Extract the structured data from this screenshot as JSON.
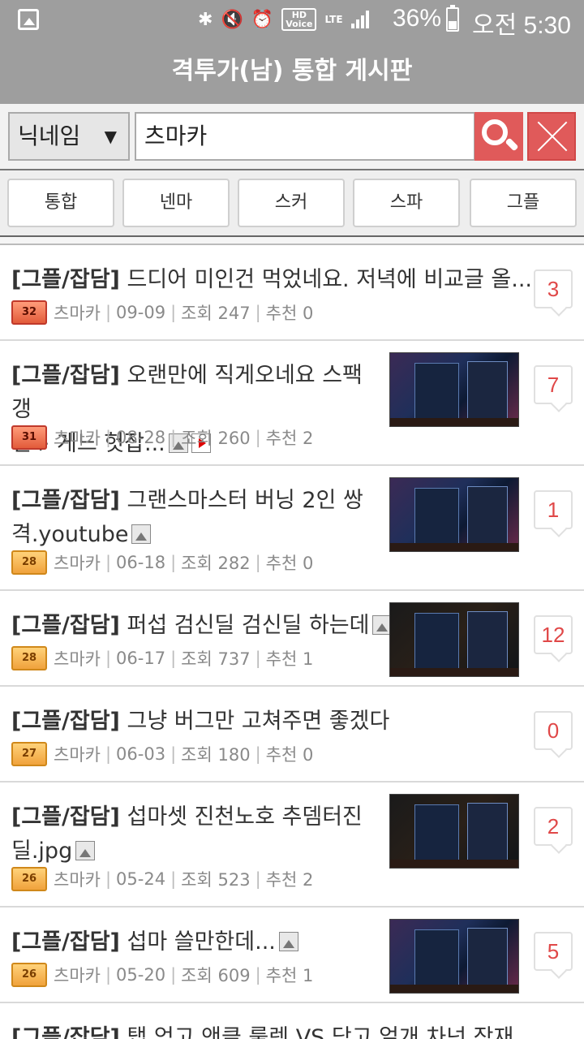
{
  "status_bar": {
    "battery": "36%",
    "time": "오전 5:30",
    "hd_label": "HD",
    "voice_label": "Voice",
    "lte_label": "LTE",
    "icons": [
      "gallery-icon",
      "bluetooth-icon",
      "mute-icon",
      "alarm-icon",
      "hd-voice-icon",
      "lte-icon",
      "signal-icon",
      "battery-icon"
    ]
  },
  "header": {
    "title": "격투가(남) 통합 게시판"
  },
  "search": {
    "field_select": "닉네임",
    "caret": "▼",
    "query": "츠마카"
  },
  "tabs": [
    "통합",
    "넨마",
    "스커",
    "스파",
    "그플"
  ],
  "posts": [
    {
      "category": "[그플/잡담]",
      "title": " 드디어 미인건 먹었네요. 저녁에 비교글 올...",
      "title2": "",
      "level": "32",
      "level_color": "red",
      "author": "츠마카",
      "date": "09-09",
      "views": "조회 247",
      "recommend": "추천 0",
      "comments": "3",
      "has_image": false,
      "has_video": false,
      "has_thumb": false
    },
    {
      "category": "[그플/잡담]",
      "title": " 오랜만에 직게오네요 스팩갱",
      "title2": "신+ 게느 헛잡...",
      "level": "31",
      "level_color": "red",
      "author": "츠마카",
      "date": "08-28",
      "views": "조회 260",
      "recommend": "추천 2",
      "comments": "7",
      "has_image": true,
      "has_video": true,
      "has_thumb": true
    },
    {
      "category": "[그플/잡담]",
      "title": " 그랜스마스터 버닝 2인 쌍",
      "title2": "격.youtube",
      "level": "28",
      "level_color": "orange",
      "author": "츠마카",
      "date": "06-18",
      "views": "조회 282",
      "recommend": "추천 0",
      "comments": "1",
      "has_image": true,
      "has_video": false,
      "has_thumb": true
    },
    {
      "category": "[그플/잡담]",
      "title": " 퍼섭 검신딜 검신딜 하는데",
      "title2": "",
      "level": "28",
      "level_color": "orange",
      "author": "츠마카",
      "date": "06-17",
      "views": "조회 737",
      "recommend": "추천 1",
      "comments": "12",
      "has_image": true,
      "has_video": false,
      "has_thumb": true
    },
    {
      "category": "[그플/잡담]",
      "title": " 그냥 버그만 고쳐주면 좋겠다",
      "title2": "",
      "level": "27",
      "level_color": "orange",
      "author": "츠마카",
      "date": "06-03",
      "views": "조회 180",
      "recommend": "추천 0",
      "comments": "0",
      "has_image": false,
      "has_video": false,
      "has_thumb": false
    },
    {
      "category": "[그플/잡담]",
      "title": " 섭마셋 진천노호 추뎀터진",
      "title2": "딜.jpg",
      "level": "26",
      "level_color": "orange",
      "author": "츠마카",
      "date": "05-24",
      "views": "조회 523",
      "recommend": "추천 2",
      "comments": "2",
      "has_image": true,
      "has_video": false,
      "has_thumb": true
    },
    {
      "category": "[그플/잡담]",
      "title": " 섭마 쓸만한데...",
      "title2": "",
      "level": "26",
      "level_color": "orange",
      "author": "츠마카",
      "date": "05-20",
      "views": "조회 609",
      "recommend": "추천 1",
      "comments": "5",
      "has_image": true,
      "has_video": false,
      "has_thumb": true
    },
    {
      "category": "[그플/잡담]",
      "title": " 탭 얻고 앤클 룰렛 VS 닥고 얼개 차넌 작재",
      "title2": "",
      "level": "",
      "level_color": "orange",
      "author": "",
      "date": "",
      "views": "",
      "recommend": "",
      "comments": "",
      "has_image": false,
      "has_video": false,
      "has_thumb": false
    }
  ]
}
